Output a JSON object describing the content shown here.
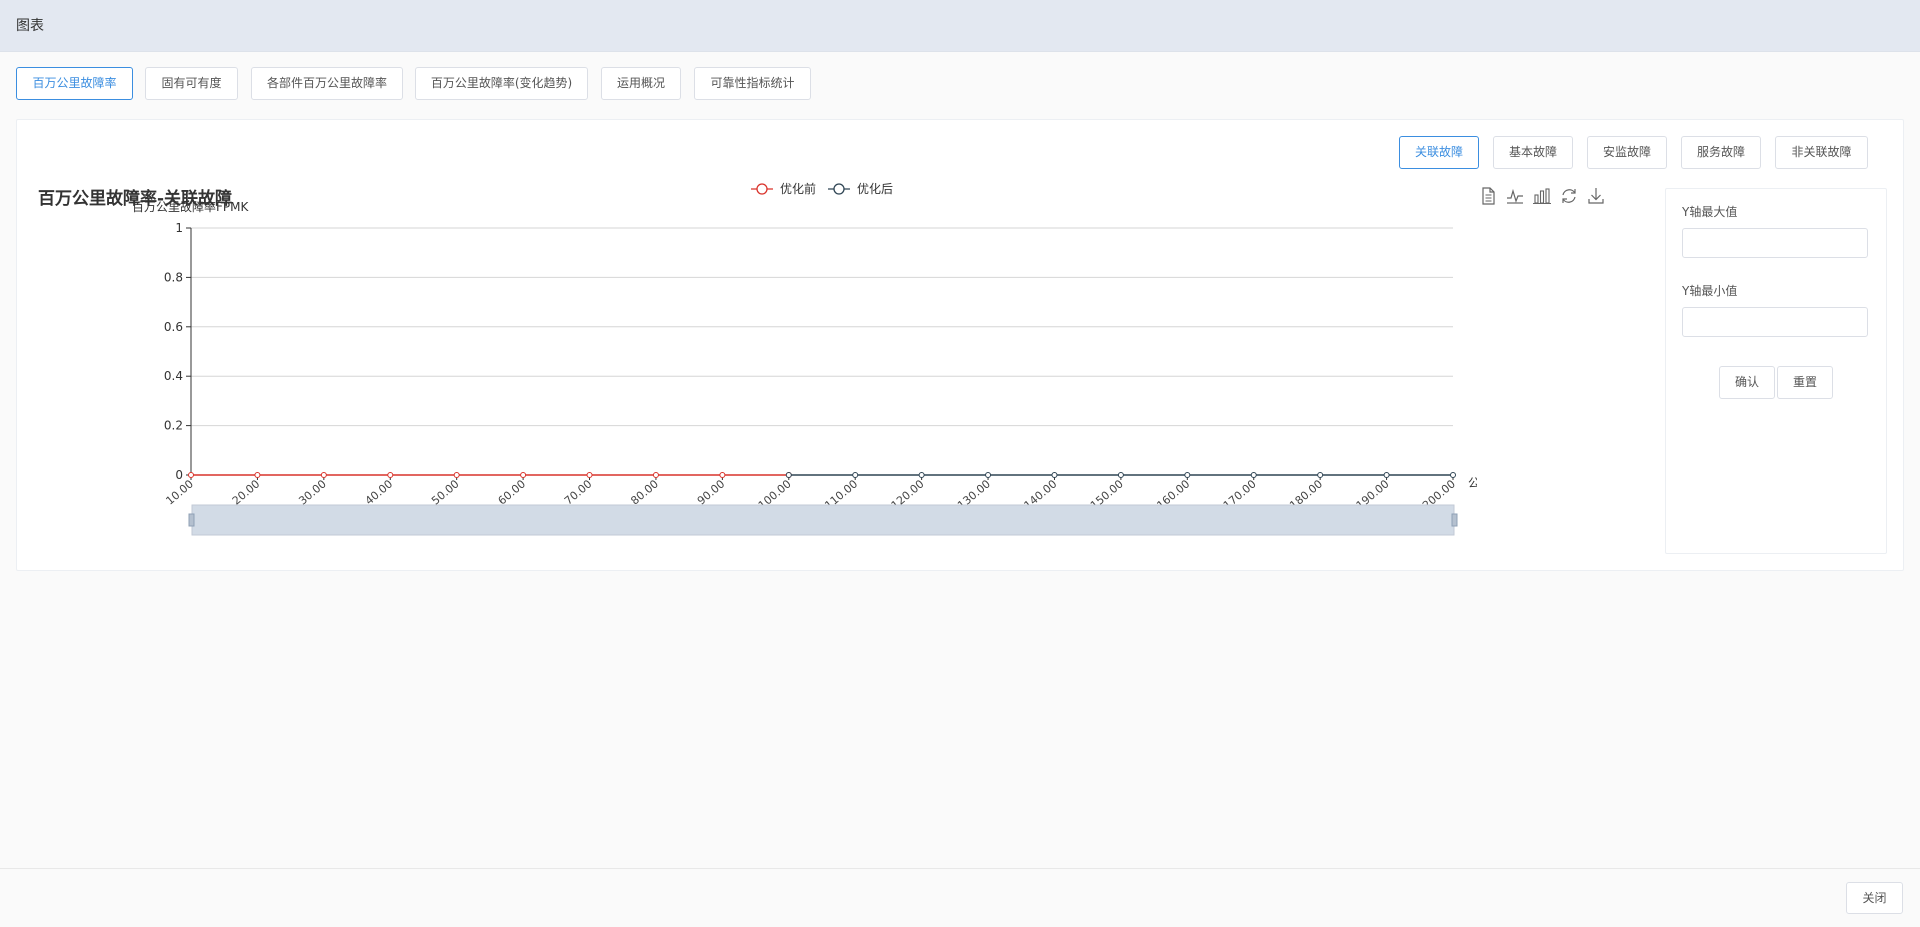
{
  "window": {
    "title": "图表"
  },
  "main_tabs": [
    {
      "label": "百万公里故障率",
      "active": true
    },
    {
      "label": "固有可有度",
      "active": false
    },
    {
      "label": "各部件百万公里故障率",
      "active": false
    },
    {
      "label": "百万公里故障率(变化趋势)",
      "active": false
    },
    {
      "label": "运用概况",
      "active": false
    },
    {
      "label": "可靠性指标统计",
      "active": false
    }
  ],
  "sub_tabs": [
    {
      "label": "关联故障",
      "active": true
    },
    {
      "label": "基本故障",
      "active": false
    },
    {
      "label": "安监故障",
      "active": false
    },
    {
      "label": "服务故障",
      "active": false
    },
    {
      "label": "非关联故障",
      "active": false
    }
  ],
  "toolbox": {
    "icons": [
      "data-view-icon",
      "line-chart-icon",
      "bar-chart-icon",
      "restore-icon",
      "download-icon"
    ]
  },
  "chart_data": {
    "type": "line",
    "title": "百万公里故障率-关联故障",
    "ylabel": "百万公里故障率FPMK",
    "xlabel": "公里",
    "x": [
      "10.00",
      "20.00",
      "30.00",
      "40.00",
      "50.00",
      "60.00",
      "70.00",
      "80.00",
      "90.00",
      "100.00",
      "110.00",
      "120.00",
      "130.00",
      "140.00",
      "150.00",
      "160.00",
      "170.00",
      "180.00",
      "190.00",
      "200.00"
    ],
    "yticks": [
      "0",
      "0.2",
      "0.4",
      "0.6",
      "0.8",
      "1"
    ],
    "ylim": [
      0,
      1
    ],
    "series": [
      {
        "name": "优化前",
        "color": "#d9332b",
        "values": [
          0,
          0,
          0,
          0,
          0,
          0,
          0,
          0,
          0,
          0
        ]
      },
      {
        "name": "优化后",
        "color": "#2f4554",
        "values": [
          null,
          null,
          null,
          null,
          null,
          null,
          null,
          null,
          null,
          0,
          0,
          0,
          0,
          0,
          0,
          0,
          0,
          0,
          0,
          0
        ]
      }
    ],
    "grid": true,
    "legend": "top-center",
    "datazoom": true
  },
  "side_form": {
    "ymax_label": "Y轴最大值",
    "ymax_value": "",
    "ymin_label": "Y轴最小值",
    "ymin_value": "",
    "confirm_label": "确认",
    "reset_label": "重置"
  },
  "footer": {
    "close_label": "关闭"
  }
}
